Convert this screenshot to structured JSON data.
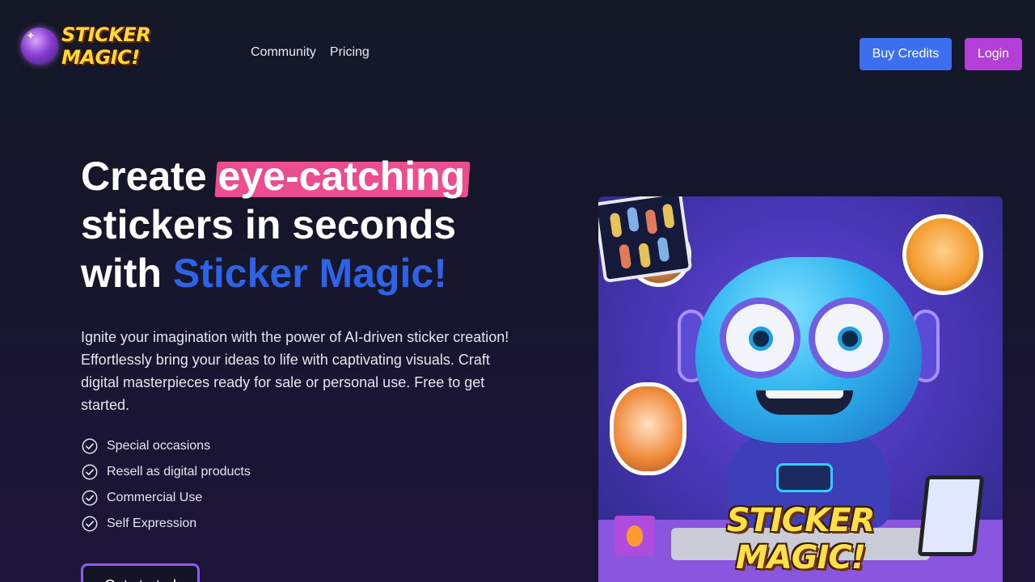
{
  "header": {
    "logo_text": "STICKER MAGIC!",
    "nav": [
      {
        "label": "Community"
      },
      {
        "label": "Pricing"
      }
    ],
    "buy_credits_label": "Buy Credits",
    "login_label": "Login"
  },
  "hero": {
    "title_part1": "Create ",
    "title_highlight": "eye-catching",
    "title_part2": "stickers in seconds",
    "title_part3": "with ",
    "title_brand": "Sticker Magic!",
    "description": "Ignite your imagination with the power of AI-driven sticker creation! Effortlessly bring your ideas to life with captivating visuals. Craft digital masterpieces ready for sale or personal use. Free to get started.",
    "features": [
      {
        "label": "Special occasions",
        "icon": "check-circle-icon"
      },
      {
        "label": "Resell as digital products",
        "icon": "check-circle-icon"
      },
      {
        "label": "Commercial Use",
        "icon": "check-circle-icon"
      },
      {
        "label": "Self Expression",
        "icon": "check-circle-icon"
      }
    ],
    "cta_label": "Get started"
  },
  "hero_image": {
    "overlay_text": "STICKER MAGIC!"
  },
  "colors": {
    "background": "#141827",
    "buy_credits": "#3b6ff0",
    "login": "#b43fd8",
    "highlight_pink": "#ec4d8f",
    "brand_blue": "#2f63e6",
    "cta_border": "#8a5cf0"
  }
}
